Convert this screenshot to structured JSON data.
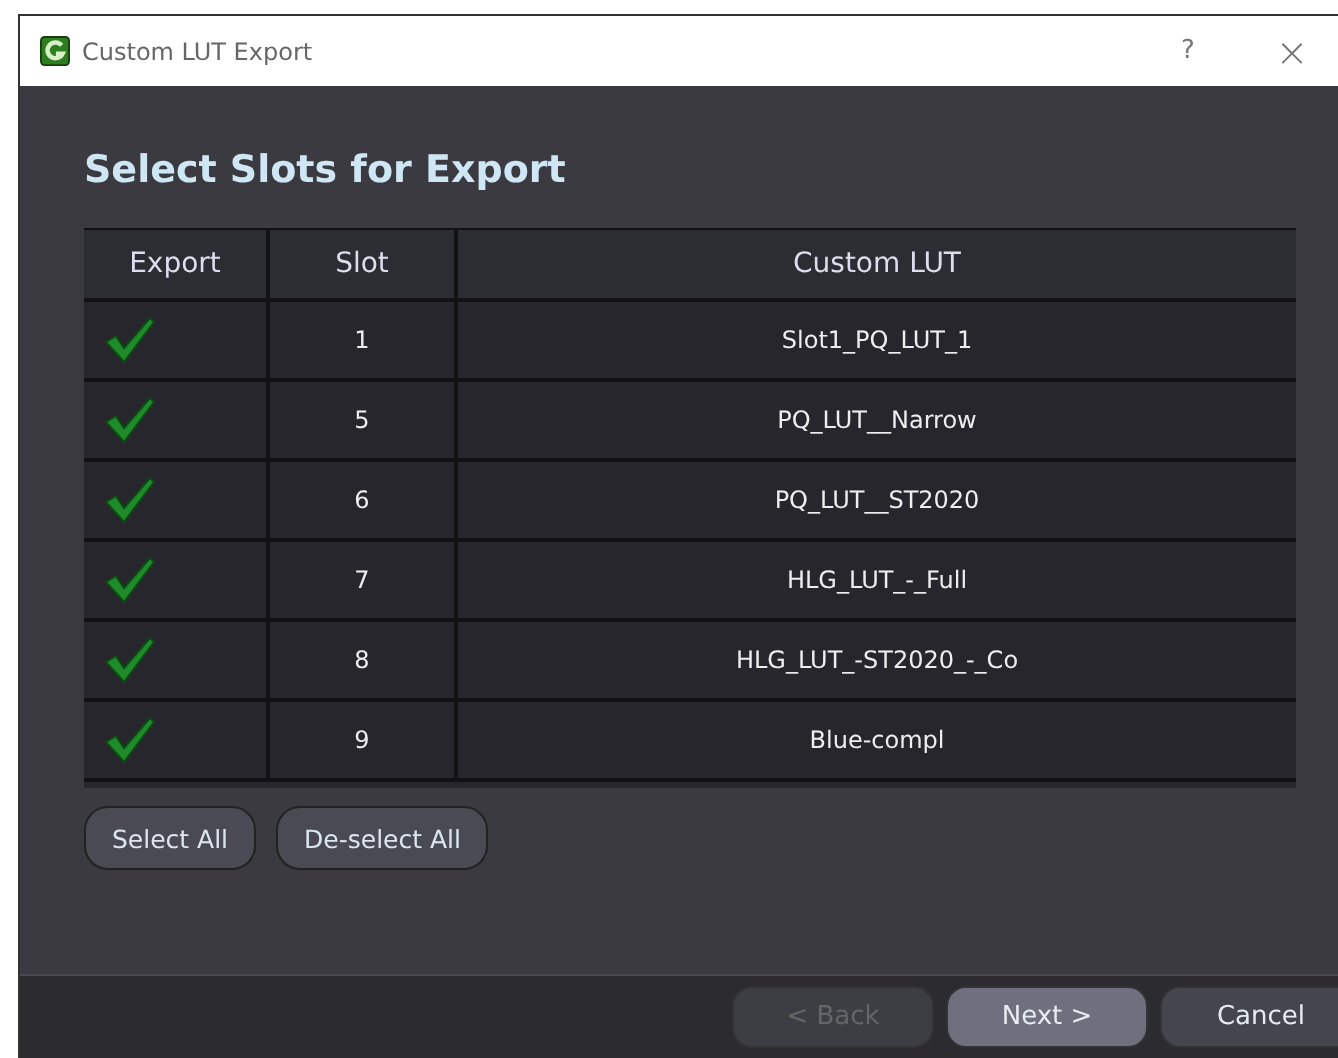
{
  "window": {
    "title": "Custom LUT Export",
    "help": "?",
    "close": "×"
  },
  "heading": "Select Slots for Export",
  "table": {
    "columns": [
      "Export",
      "Slot",
      "Custom LUT"
    ],
    "rows": [
      {
        "checked": true,
        "slot": "1",
        "lut": "Slot1_PQ_LUT_1"
      },
      {
        "checked": true,
        "slot": "5",
        "lut": "PQ_LUT__Narrow"
      },
      {
        "checked": true,
        "slot": "6",
        "lut": "PQ_LUT__ST2020"
      },
      {
        "checked": true,
        "slot": "7",
        "lut": "HLG_LUT_-_Full"
      },
      {
        "checked": true,
        "slot": "8",
        "lut": "HLG_LUT_-ST2020_-_Co"
      },
      {
        "checked": true,
        "slot": "9",
        "lut": "Blue-compl"
      }
    ]
  },
  "selection_buttons": [
    "Select All",
    "De-select All"
  ],
  "footer_buttons": [
    {
      "label": "< Back",
      "disabled": true
    },
    {
      "label": "Next >",
      "disabled": false,
      "kind": "primary"
    },
    {
      "label": "Cancel",
      "disabled": false
    }
  ]
}
